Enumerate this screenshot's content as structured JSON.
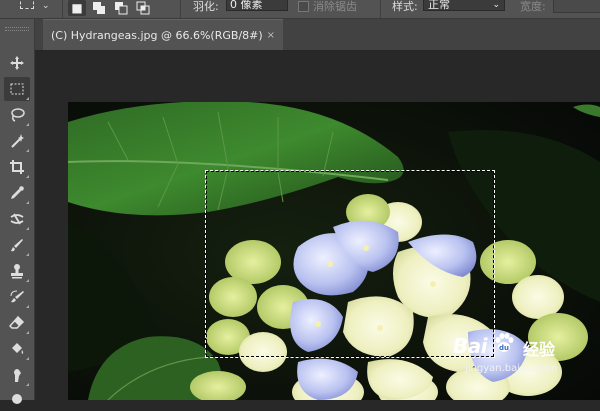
{
  "options_bar": {
    "tool_preset_icon": "rectangular-marquee-icon",
    "selection_modes": [
      {
        "icon": "new-selection-icon",
        "active": true
      },
      {
        "icon": "add-to-selection-icon",
        "active": false
      },
      {
        "icon": "subtract-from-selection-icon",
        "active": false
      },
      {
        "icon": "intersect-selection-icon",
        "active": false
      }
    ],
    "feather_label": "羽化:",
    "feather_value": "0 像素",
    "antialias_label": "消除锯齿",
    "style_label": "样式:",
    "style_value": "正常",
    "width_label": "宽度:"
  },
  "toolbar": {
    "tools": [
      {
        "name": "move-tool",
        "icon": "move-icon"
      },
      {
        "name": "rectangular-marquee-tool",
        "icon": "marquee-icon",
        "active": true
      },
      {
        "name": "lasso-tool",
        "icon": "lasso-icon"
      },
      {
        "name": "magic-wand-tool",
        "icon": "magic-wand-icon"
      },
      {
        "name": "crop-tool",
        "icon": "crop-icon"
      },
      {
        "name": "eyedropper-tool",
        "icon": "eyedropper-icon"
      },
      {
        "name": "healing-brush-tool",
        "icon": "healing-brush-icon"
      },
      {
        "name": "brush-tool",
        "icon": "brush-icon"
      },
      {
        "name": "clone-stamp-tool",
        "icon": "clone-stamp-icon"
      },
      {
        "name": "history-brush-tool",
        "icon": "history-brush-icon"
      },
      {
        "name": "eraser-tool",
        "icon": "eraser-icon"
      },
      {
        "name": "paint-bucket-tool",
        "icon": "paint-bucket-icon"
      },
      {
        "name": "smudge-tool",
        "icon": "smudge-icon"
      },
      {
        "name": "dodge-tool",
        "icon": "dodge-icon"
      }
    ]
  },
  "document": {
    "tab_title": "(C) Hydrangeas.jpg @ 66.6%(RGB/8#)",
    "close_symbol": "×"
  },
  "watermark": {
    "brand": "Bai",
    "brand_suffix": "经验",
    "url": "jingyan.baidu.com"
  },
  "colors": {
    "panel": "#535353",
    "tabbar": "#424242",
    "workspace": "#282828",
    "text": "#e8e8e8"
  }
}
